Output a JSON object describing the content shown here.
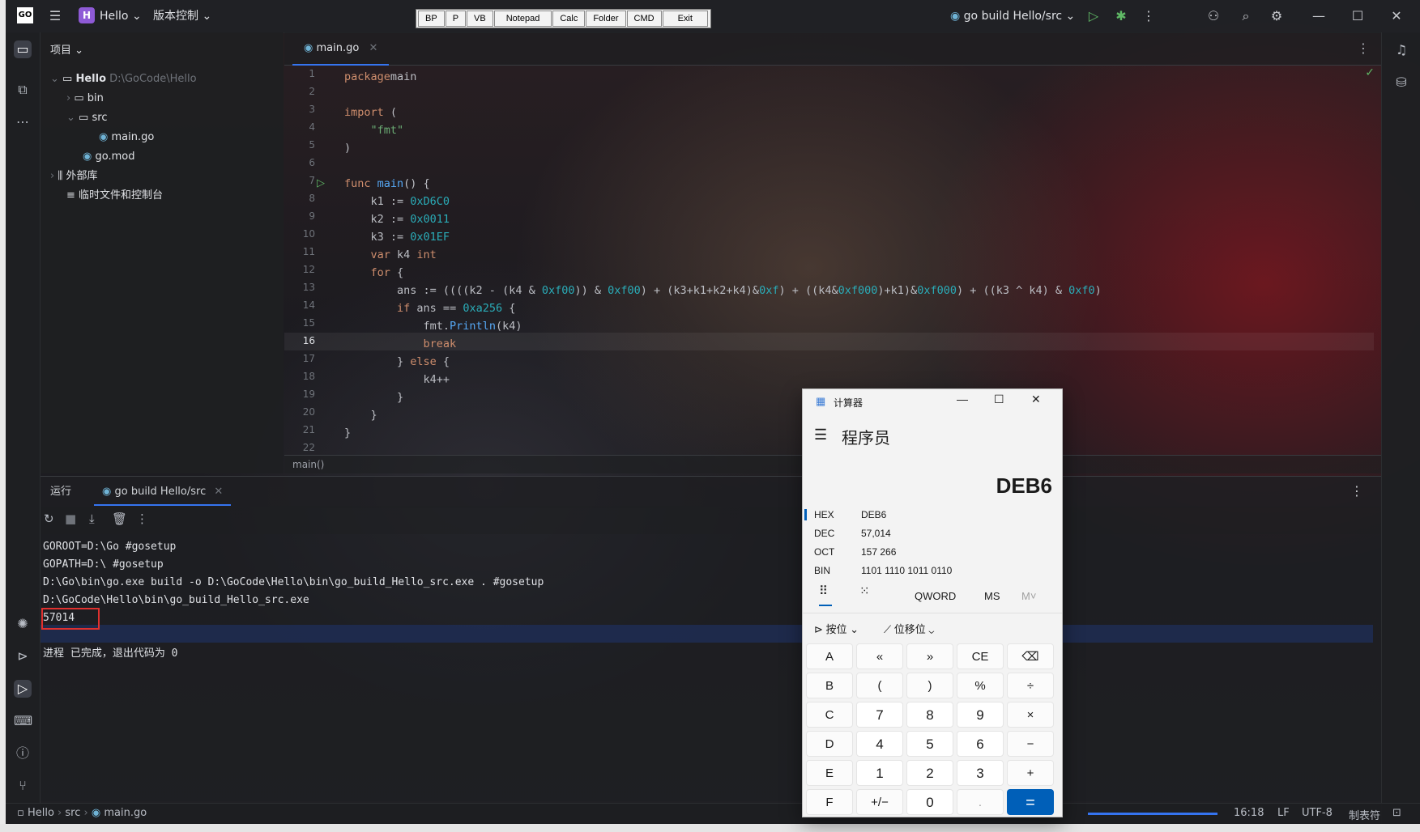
{
  "window": {
    "app_badge": "H",
    "project_name": "Hello",
    "vcs_menu": "版本控制",
    "run_config": "go build Hello/src"
  },
  "toolbar_buttons": [
    "BP",
    "P",
    "VB",
    "Notepad",
    "Calc",
    "Folder",
    "CMD",
    "Exit"
  ],
  "project_panel": {
    "header": "项目",
    "tree": [
      {
        "label": "Hello",
        "hint": "D:\\GoCode\\Hello"
      },
      {
        "label": "bin"
      },
      {
        "label": "src"
      },
      {
        "label": "main.go"
      },
      {
        "label": "go.mod"
      },
      {
        "label": "外部库"
      },
      {
        "label": "临时文件和控制台"
      }
    ]
  },
  "editor": {
    "tab_label": "main.go",
    "line_numbers": [
      "1",
      "2",
      "3",
      "4",
      "5",
      "6",
      "7",
      "8",
      "9",
      "10",
      "11",
      "12",
      "13",
      "14",
      "15",
      "16",
      "17",
      "18",
      "19",
      "20",
      "21",
      "22"
    ],
    "breadcrumb": "main()"
  },
  "run_panel": {
    "title": "运行",
    "tab_label": "go build Hello/src",
    "console_lines": [
      "GOROOT=D:\\Go #gosetup",
      "GOPATH=D:\\ #gosetup",
      "D:\\Go\\bin\\go.exe build -o D:\\GoCode\\Hello\\bin\\go_build_Hello_src.exe . #gosetup",
      "D:\\GoCode\\Hello\\bin\\go_build_Hello_src.exe",
      "57014",
      "",
      "进程 已完成，退出代码为 0"
    ]
  },
  "status_bar": {
    "crumbs": [
      "Hello",
      "src",
      "main.go"
    ],
    "right": [
      "16:18",
      "LF",
      "UTF-8",
      "制表符"
    ]
  },
  "calculator": {
    "title": "计算器",
    "mode": "程序员",
    "display": "DEB6",
    "radix": [
      {
        "label": "HEX",
        "value": "DEB6"
      },
      {
        "label": "DEC",
        "value": "57,014"
      },
      {
        "label": "OCT",
        "value": "157 266"
      },
      {
        "label": "BIN",
        "value": "1101 1110 1011 0110"
      }
    ],
    "word_size": "QWORD",
    "memory": [
      "MS",
      "M˅"
    ],
    "bitwise_menu": "按位",
    "bitshift_menu": "位移位",
    "keys": [
      [
        "A",
        "«",
        "»",
        "CE",
        "⌫"
      ],
      [
        "B",
        "(",
        ")",
        "%",
        "÷"
      ],
      [
        "C",
        "7",
        "8",
        "9",
        "×"
      ],
      [
        "D",
        "4",
        "5",
        "6",
        "−"
      ],
      [
        "E",
        "1",
        "2",
        "3",
        "+"
      ],
      [
        "F",
        "+/−",
        "0",
        ".",
        "="
      ]
    ]
  },
  "colors": {
    "accent": "#3574f0",
    "calc_equals": "#005fb8",
    "highlight_box": "#e0312f"
  }
}
